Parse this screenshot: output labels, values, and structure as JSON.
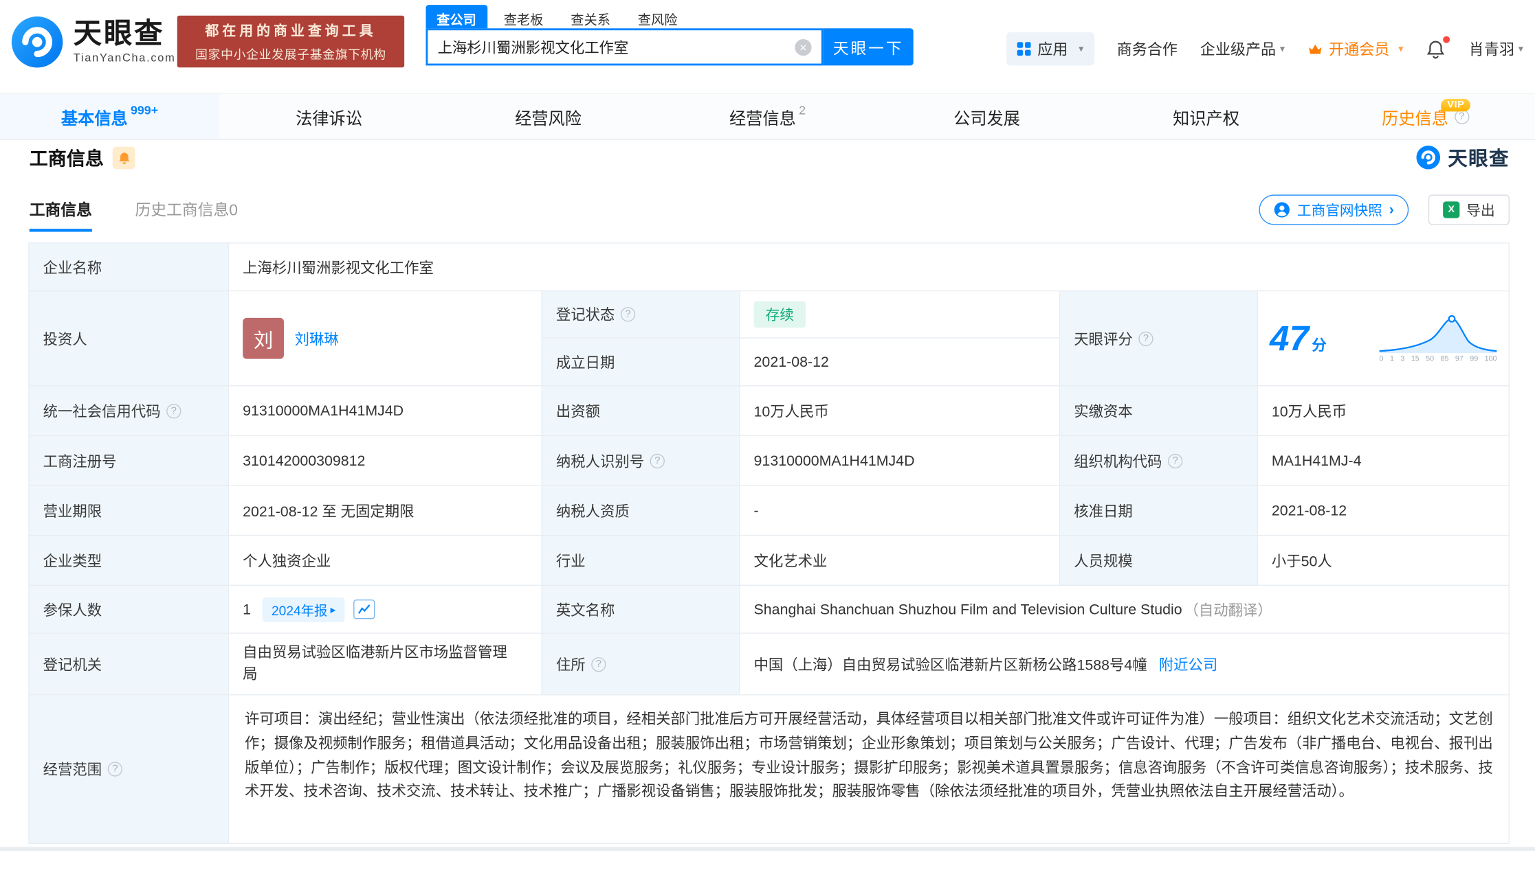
{
  "brand": {
    "name_cn": "天眼查",
    "name_en": "TianYanCha.com",
    "watermark": "天眼查"
  },
  "promo": {
    "line1": "都在用的商业查询工具",
    "line2": "国家中小企业发展子基金旗下机构"
  },
  "search": {
    "tabs": [
      {
        "label": "查公司"
      },
      {
        "label": "查老板"
      },
      {
        "label": "查关系"
      },
      {
        "label": "查风险"
      }
    ],
    "value": "上海杉川蜀洲影视文化工作室",
    "button": "天眼一下"
  },
  "top_menu": {
    "apps": "应用",
    "cooperation": "商务合作",
    "enterprise": "企业级产品",
    "vip": "开通会员",
    "user": "肖青羽"
  },
  "nav": {
    "tabs": [
      {
        "label": "基本信息",
        "badge": "999+"
      },
      {
        "label": "法律诉讼"
      },
      {
        "label": "经营风险"
      },
      {
        "label": "经营信息",
        "badge": "2"
      },
      {
        "label": "公司发展"
      },
      {
        "label": "知识产权"
      },
      {
        "label": "历史信息",
        "vip_tag": "VIP"
      }
    ]
  },
  "section": {
    "title": "工商信息",
    "sub_tabs": [
      {
        "label": "工商信息"
      },
      {
        "label": "历史工商信息0"
      }
    ],
    "snapshot_btn": "工商官网快照",
    "export_btn": "导出"
  },
  "fields": {
    "company_name": {
      "label": "企业名称",
      "value": "上海杉川蜀洲影视文化工作室"
    },
    "investor": {
      "label": "投资人",
      "avatar": "刘",
      "value": "刘琳琳"
    },
    "reg_status": {
      "label": "登记状态",
      "value": "存续"
    },
    "establish_date": {
      "label": "成立日期",
      "value": "2021-08-12"
    },
    "score": {
      "label": "天眼评分",
      "value": "47",
      "unit": "分",
      "axis": [
        "0",
        "1",
        "3",
        "15",
        "50",
        "85",
        "97",
        "99",
        "100"
      ]
    },
    "credit_code": {
      "label": "统一社会信用代码",
      "value": "91310000MA1H41MJ4D"
    },
    "capital": {
      "label": "出资额",
      "value": "10万人民币"
    },
    "paid_capital": {
      "label": "实缴资本",
      "value": "10万人民币"
    },
    "reg_number": {
      "label": "工商注册号",
      "value": "310142000309812"
    },
    "taxpayer_id": {
      "label": "纳税人识别号",
      "value": "91310000MA1H41MJ4D"
    },
    "org_code": {
      "label": "组织机构代码",
      "value": "MA1H41MJ-4"
    },
    "business_term": {
      "label": "营业期限",
      "value": "2021-08-12 至 无固定期限"
    },
    "taxpayer_quality": {
      "label": "纳税人资质",
      "value": "-"
    },
    "approval_date": {
      "label": "核准日期",
      "value": "2021-08-12"
    },
    "company_type": {
      "label": "企业类型",
      "value": "个人独资企业"
    },
    "industry": {
      "label": "行业",
      "value": "文化艺术业"
    },
    "staff_size": {
      "label": "人员规模",
      "value": "小于50人"
    },
    "insured_count": {
      "label": "参保人数",
      "value": "1",
      "tag": "2024年报"
    },
    "english_name": {
      "label": "英文名称",
      "value": "Shanghai Shanchuan Shuzhou Film and Television Culture Studio",
      "note": "（自动翻译）"
    },
    "reg_authority": {
      "label": "登记机关",
      "value": "自由贸易试验区临港新片区市场监督管理局"
    },
    "address": {
      "label": "住所",
      "value": "中国（上海）自由贸易试验区临港新片区新杨公路1588号4幢",
      "link": "附近公司"
    },
    "business_scope": {
      "label": "经营范围",
      "value": "许可项目：演出经纪；营业性演出（依法须经批准的项目，经相关部门批准后方可开展经营活动，具体经营项目以相关部门批准文件或许可证件为准）一般项目：组织文化艺术交流活动；文艺创作；摄像及视频制作服务；租借道具活动；文化用品设备出租；服装服饰出租；市场营销策划；企业形象策划；项目策划与公关服务；广告设计、代理；广告发布（非广播电台、电视台、报刊出版单位）；广告制作；版权代理；图文设计制作；会议及展览服务；礼仪服务；专业设计服务；摄影扩印服务；影视美术道具置景服务；信息咨询服务（不含许可类信息咨询服务）；技术服务、技术开发、技术咨询、技术交流、技术转让、技术推广；广播影视设备销售；服装服饰批发；服装服饰零售（除依法须经批准的项目外，凭营业执照依法自主开展经营活动）。"
    }
  },
  "colors": {
    "brand_blue": "#0084ff",
    "vip_orange": "#ff7d00",
    "status_green": "#0cab77",
    "ribbon_red": "#ae4038",
    "label_bg": "#eff7fc"
  }
}
